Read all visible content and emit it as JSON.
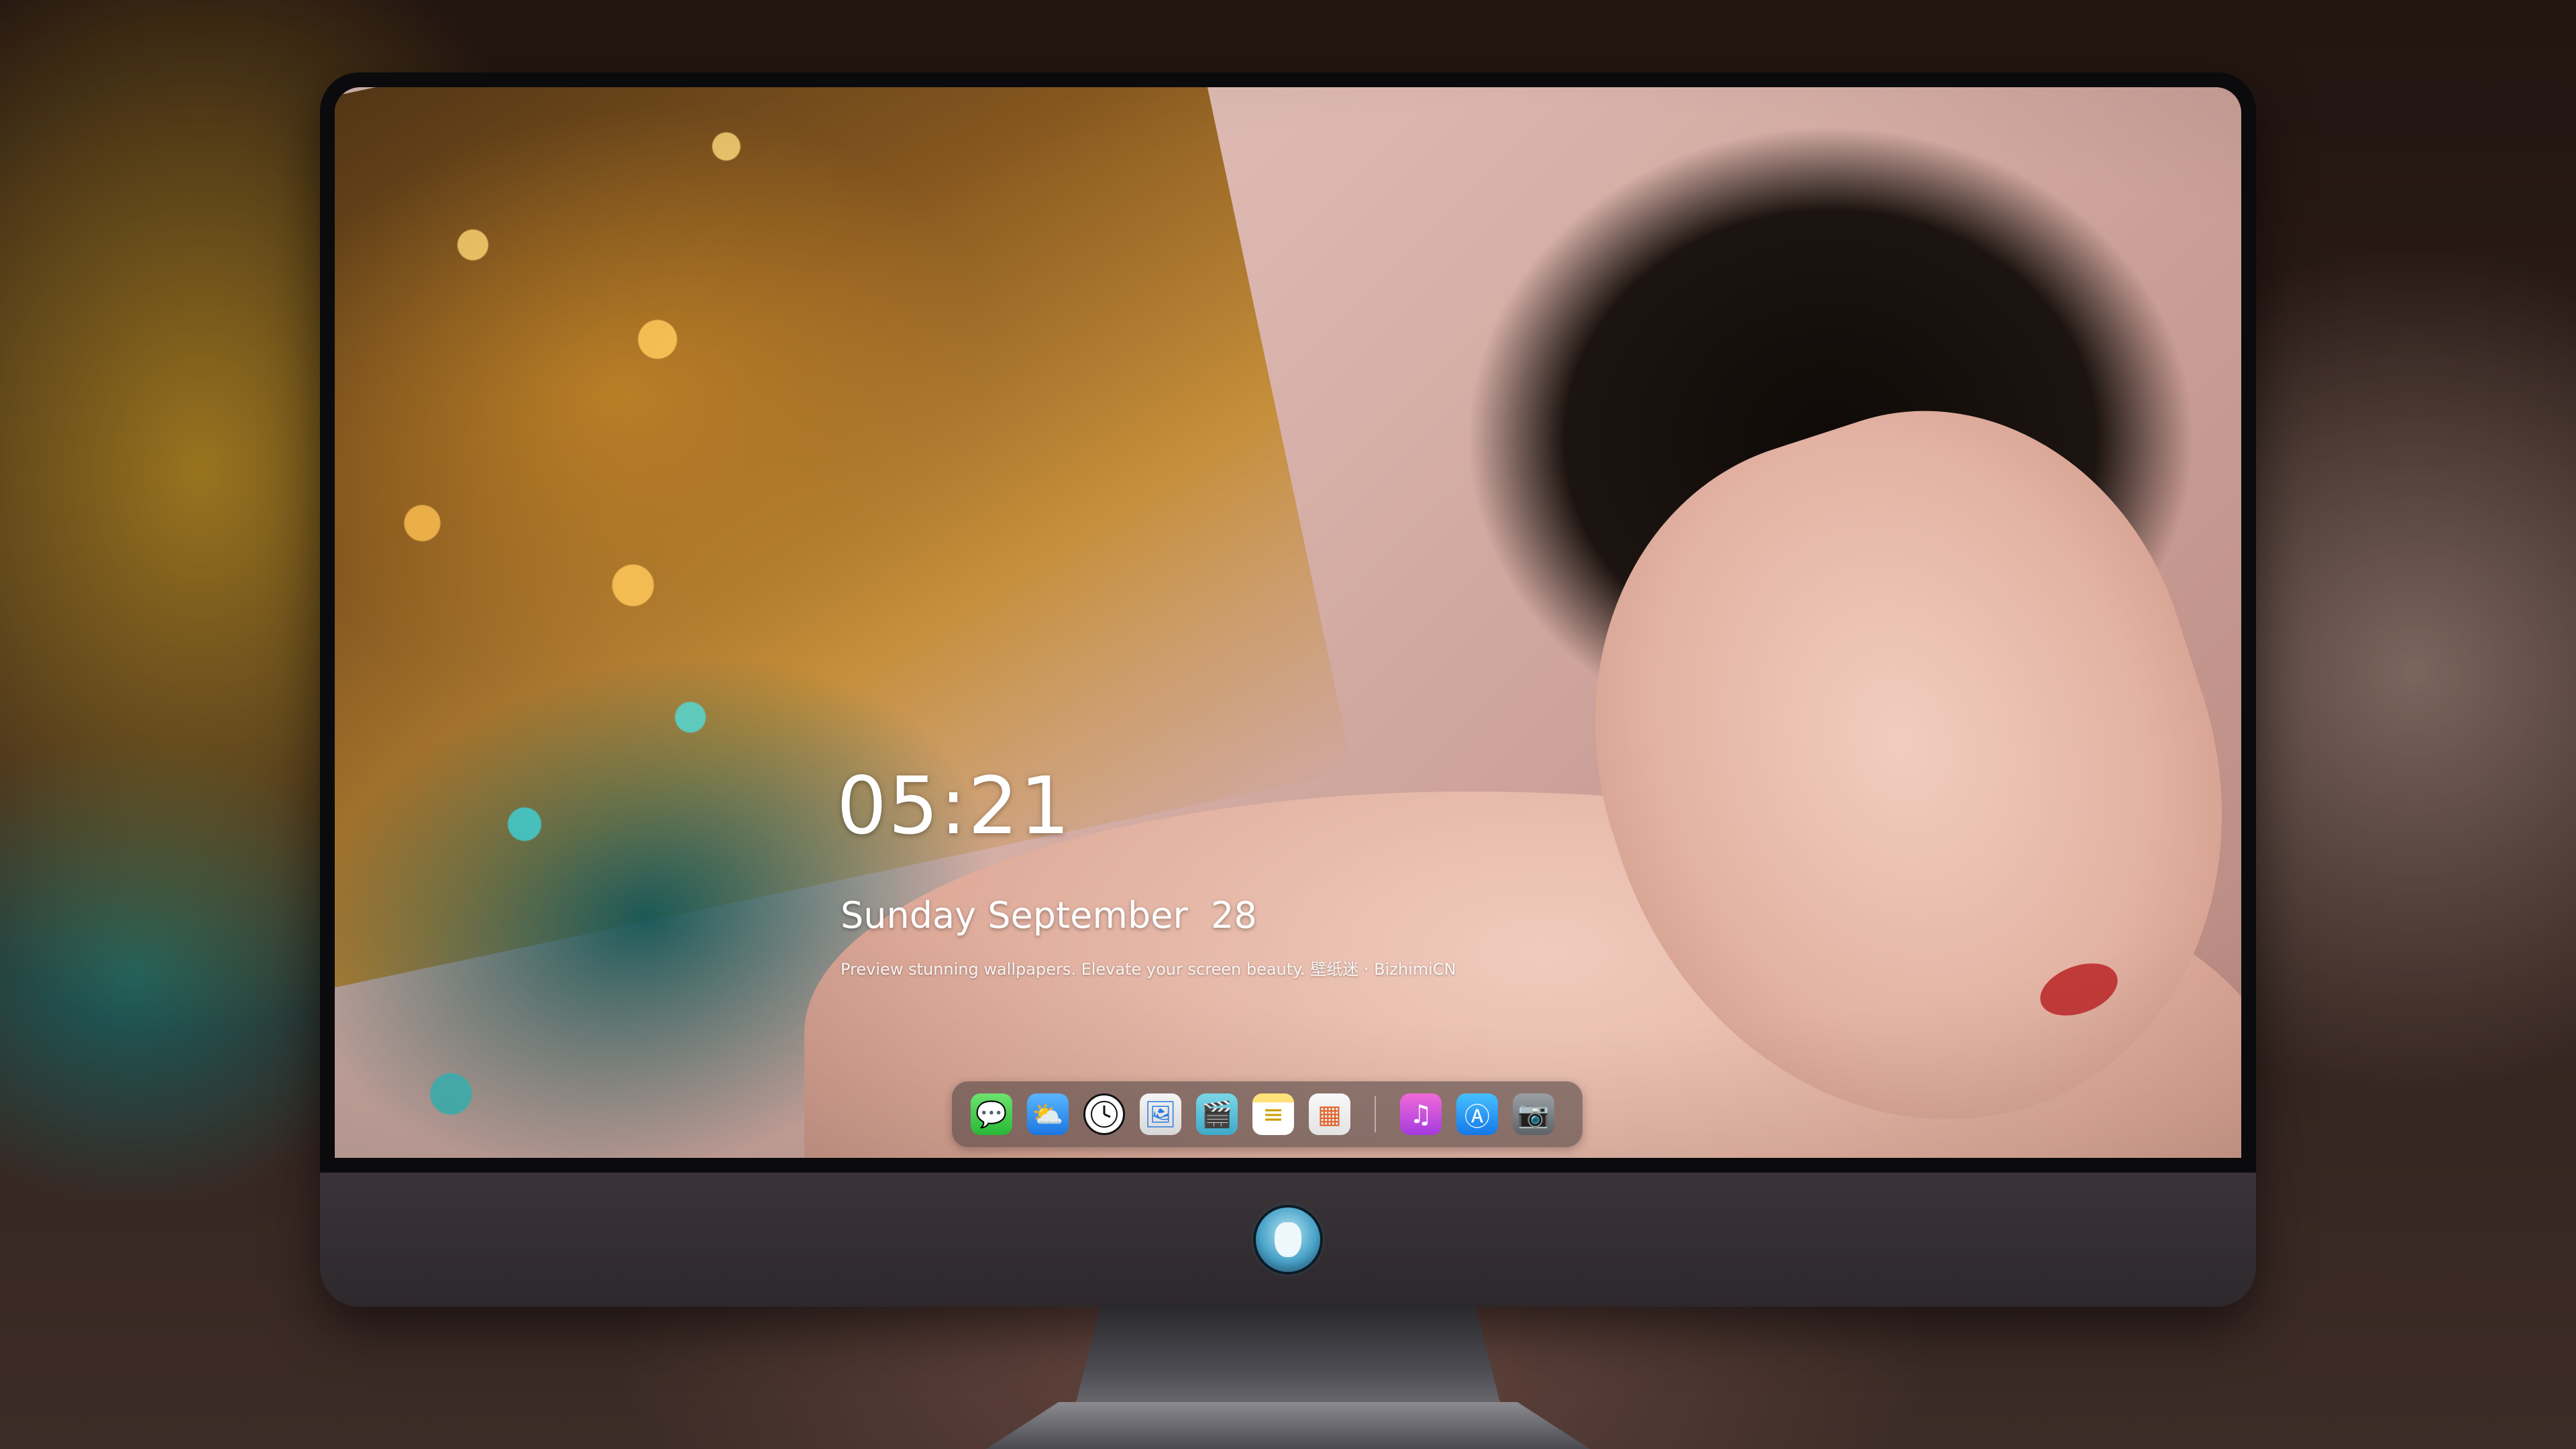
{
  "lockscreen": {
    "time": "05:21",
    "date": "Sunday September  28",
    "tagline": "Preview stunning wallpapers. Elevate your screen beauty. 壁纸迷 · BizhimiCN"
  },
  "dock": {
    "apps": [
      {
        "name": "Messages",
        "icon": "messages-icon",
        "glyph": "💬"
      },
      {
        "name": "Weather",
        "icon": "weather-icon",
        "glyph": "⛅"
      },
      {
        "name": "Clock",
        "icon": "clock-icon",
        "glyph": "🕘"
      },
      {
        "name": "Preview",
        "icon": "preview-icon",
        "glyph": "🖼"
      },
      {
        "name": "Videos",
        "icon": "clapperboard-icon",
        "glyph": "🎬"
      },
      {
        "name": "Notes",
        "icon": "notes-icon",
        "glyph": "≡"
      },
      {
        "name": "Photos",
        "icon": "photos-icon",
        "glyph": "▦"
      },
      {
        "name": "Music",
        "icon": "music-icon",
        "glyph": "♫"
      },
      {
        "name": "App Store",
        "icon": "app-store-icon",
        "glyph": "Ⓐ"
      },
      {
        "name": "Camera",
        "icon": "camera-icon",
        "glyph": "📷"
      }
    ]
  },
  "colors": {
    "bezel": "#0b0b0d",
    "chin": "#2d282c",
    "text": "#ffffff"
  }
}
